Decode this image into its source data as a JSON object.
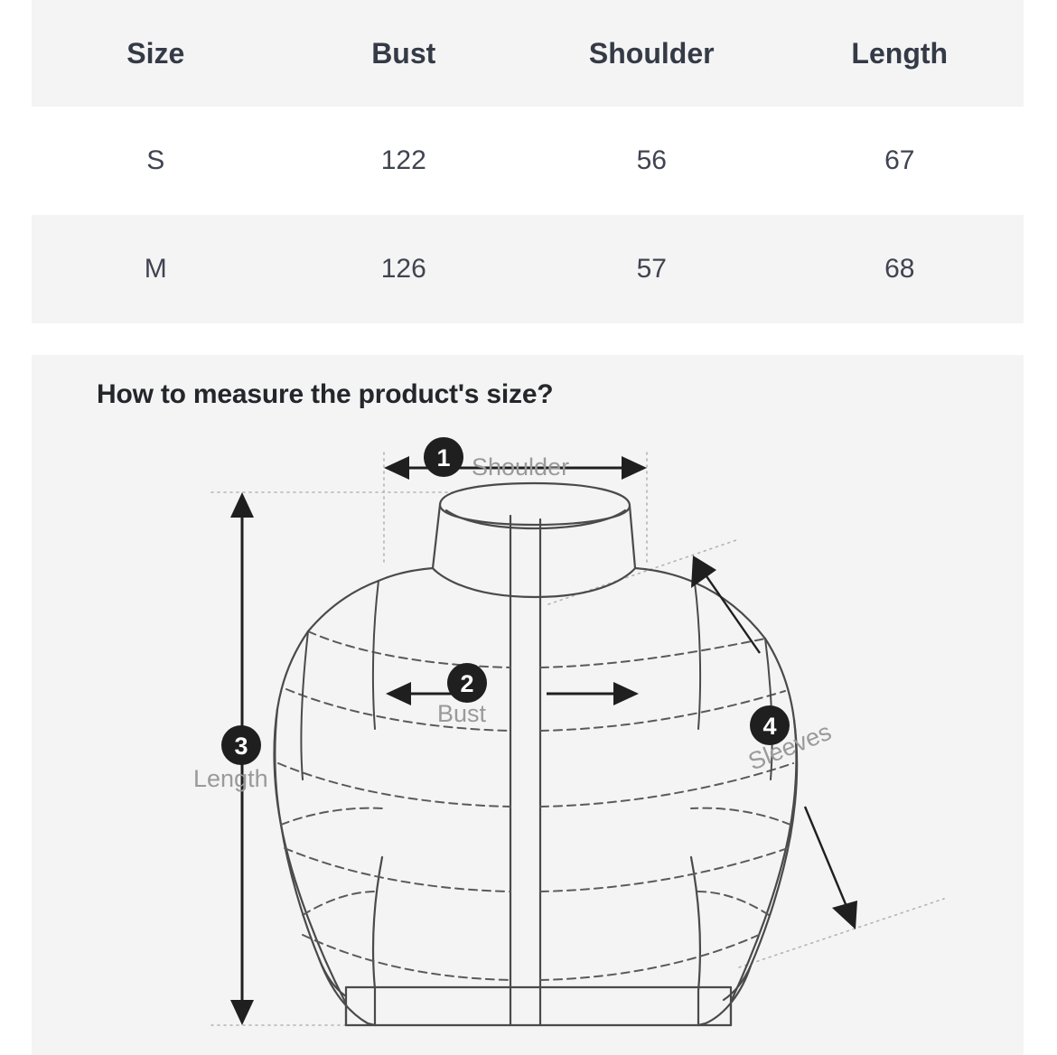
{
  "size_table": {
    "columns": [
      "Size",
      "Bust",
      "Shoulder",
      "Length"
    ],
    "rows": [
      {
        "size": "S",
        "bust": "122",
        "shoulder": "56",
        "length": "67"
      },
      {
        "size": "M",
        "bust": "126",
        "shoulder": "57",
        "length": "68"
      }
    ]
  },
  "diagram": {
    "title": "How to measure the product's size?",
    "callouts": [
      {
        "number": "1",
        "label": "Shoulder"
      },
      {
        "number": "2",
        "label": "Bust"
      },
      {
        "number": "3",
        "label": "Length"
      },
      {
        "number": "4",
        "label": "Sleeves"
      }
    ]
  },
  "colors": {
    "panel_bg": "#f4f4f4",
    "page_bg": "#ffffff",
    "header_text": "#343a46",
    "cell_text": "#3f4450",
    "title_text": "#24262b",
    "badge_fill": "#1f1f1f",
    "callout_label": "#9a9a9a",
    "jacket_outline": "#4a4a4a",
    "guide_line": "#b0b0b0"
  }
}
